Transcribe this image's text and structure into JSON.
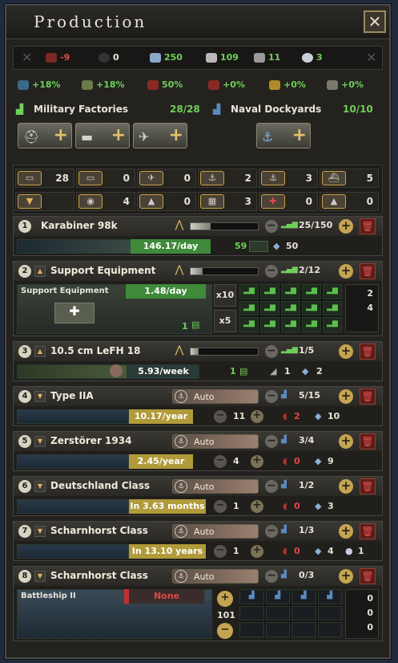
{
  "window": {
    "title": "Production",
    "close_label": "✕"
  },
  "resources": [
    {
      "icon": "oil-icon",
      "value": "-9",
      "color": "#e04848"
    },
    {
      "icon": "rubber-icon",
      "value": "0",
      "color": "#e8e4d8"
    },
    {
      "icon": "steel-icon",
      "value": "250",
      "color": "#6fd05a"
    },
    {
      "icon": "aluminium-icon",
      "value": "109",
      "color": "#6fd05a"
    },
    {
      "icon": "tungsten-icon",
      "value": "11",
      "color": "#6fd05a"
    },
    {
      "icon": "chromium-icon",
      "value": "3",
      "color": "#6fd05a"
    }
  ],
  "efficiency": [
    {
      "icon": "factory-output-icon",
      "value": "+18%"
    },
    {
      "icon": "dockyard-output-icon",
      "value": "+18%"
    },
    {
      "icon": "efficiency-icon",
      "value": "50%"
    },
    {
      "icon": "efficiency-growth-icon",
      "value": "+0%"
    },
    {
      "icon": "efficiency-cap-icon",
      "value": "+0%"
    },
    {
      "icon": "resource-gain-icon",
      "value": "+0%"
    }
  ],
  "factories": {
    "military_label": "Military Factories",
    "military_count": "28/28",
    "naval_label": "Naval Dockyards",
    "naval_count": "10/10",
    "add_buttons": [
      "infantry-equipment-icon",
      "tank-icon",
      "plane-icon"
    ],
    "naval_button": "anchor-icon"
  },
  "categories": [
    {
      "icon": "infantry-category-icon",
      "value": "28"
    },
    {
      "icon": "armor-category-icon",
      "value": "0"
    },
    {
      "icon": "air-category-icon",
      "value": "0"
    },
    {
      "icon": "naval-category-icon",
      "value": "2"
    },
    {
      "icon": "naval-category-2-icon",
      "value": "3"
    },
    {
      "icon": "convoy-category-icon",
      "value": "5"
    },
    {
      "icon": "collapse-category-icon",
      "value": ""
    },
    {
      "icon": "capital-ship-category-icon",
      "value": "4"
    },
    {
      "icon": "upgrade-category-icon",
      "value": "0"
    },
    {
      "icon": "trains-category-icon",
      "value": "3"
    },
    {
      "icon": "rocket-category-icon",
      "value": "0"
    },
    {
      "icon": "priority-category-icon",
      "value": "0"
    }
  ],
  "lines": [
    {
      "num": "1",
      "name": "Karabiner 98k",
      "count": "25/150",
      "rate": "146.17/day",
      "factories": "59",
      "stock": "50",
      "progress": 0.3
    },
    {
      "num": "2",
      "name": "Support Equipment",
      "count": "2/12",
      "equip_label": "Support Equipment",
      "rate": "1.48/day",
      "factories": "1",
      "x10": "x10",
      "x5": "x5",
      "side_a": "2",
      "side_b": "4",
      "progress": 0.18
    },
    {
      "num": "3",
      "name": "10.5 cm LeFH 18",
      "count": "1/5",
      "rate": "5.93/week",
      "factories": "1",
      "stat_a": "1",
      "stat_b": "2",
      "progress": 0.12
    },
    {
      "num": "4",
      "name": "Type IIA",
      "mode": "Auto",
      "count": "5/15",
      "rate": "10.17/year",
      "docks": "11",
      "oil": "2",
      "steel": "10"
    },
    {
      "num": "5",
      "name": "Zerstörer 1934",
      "mode": "Auto",
      "count": "3/4",
      "rate": "2.45/year",
      "docks": "4",
      "oil": "0",
      "steel": "9"
    },
    {
      "num": "6",
      "name": "Deutschland Class",
      "mode": "Auto",
      "count": "1/2",
      "rate": "In 3.63 months",
      "docks": "1",
      "oil": "0",
      "steel": "3"
    },
    {
      "num": "7",
      "name": "Scharnhorst Class",
      "mode": "Auto",
      "count": "1/3",
      "rate": "In 13.10 years",
      "docks": "1",
      "oil": "0",
      "steel": "4",
      "chrome": "1"
    },
    {
      "num": "8",
      "name": "Scharnhorst Class",
      "mode": "Auto",
      "count": "0/3",
      "equip_label": "Battleship II",
      "rate": "None",
      "docks": "101",
      "side_a": "0",
      "side_b": "0",
      "side_c": "0"
    }
  ]
}
